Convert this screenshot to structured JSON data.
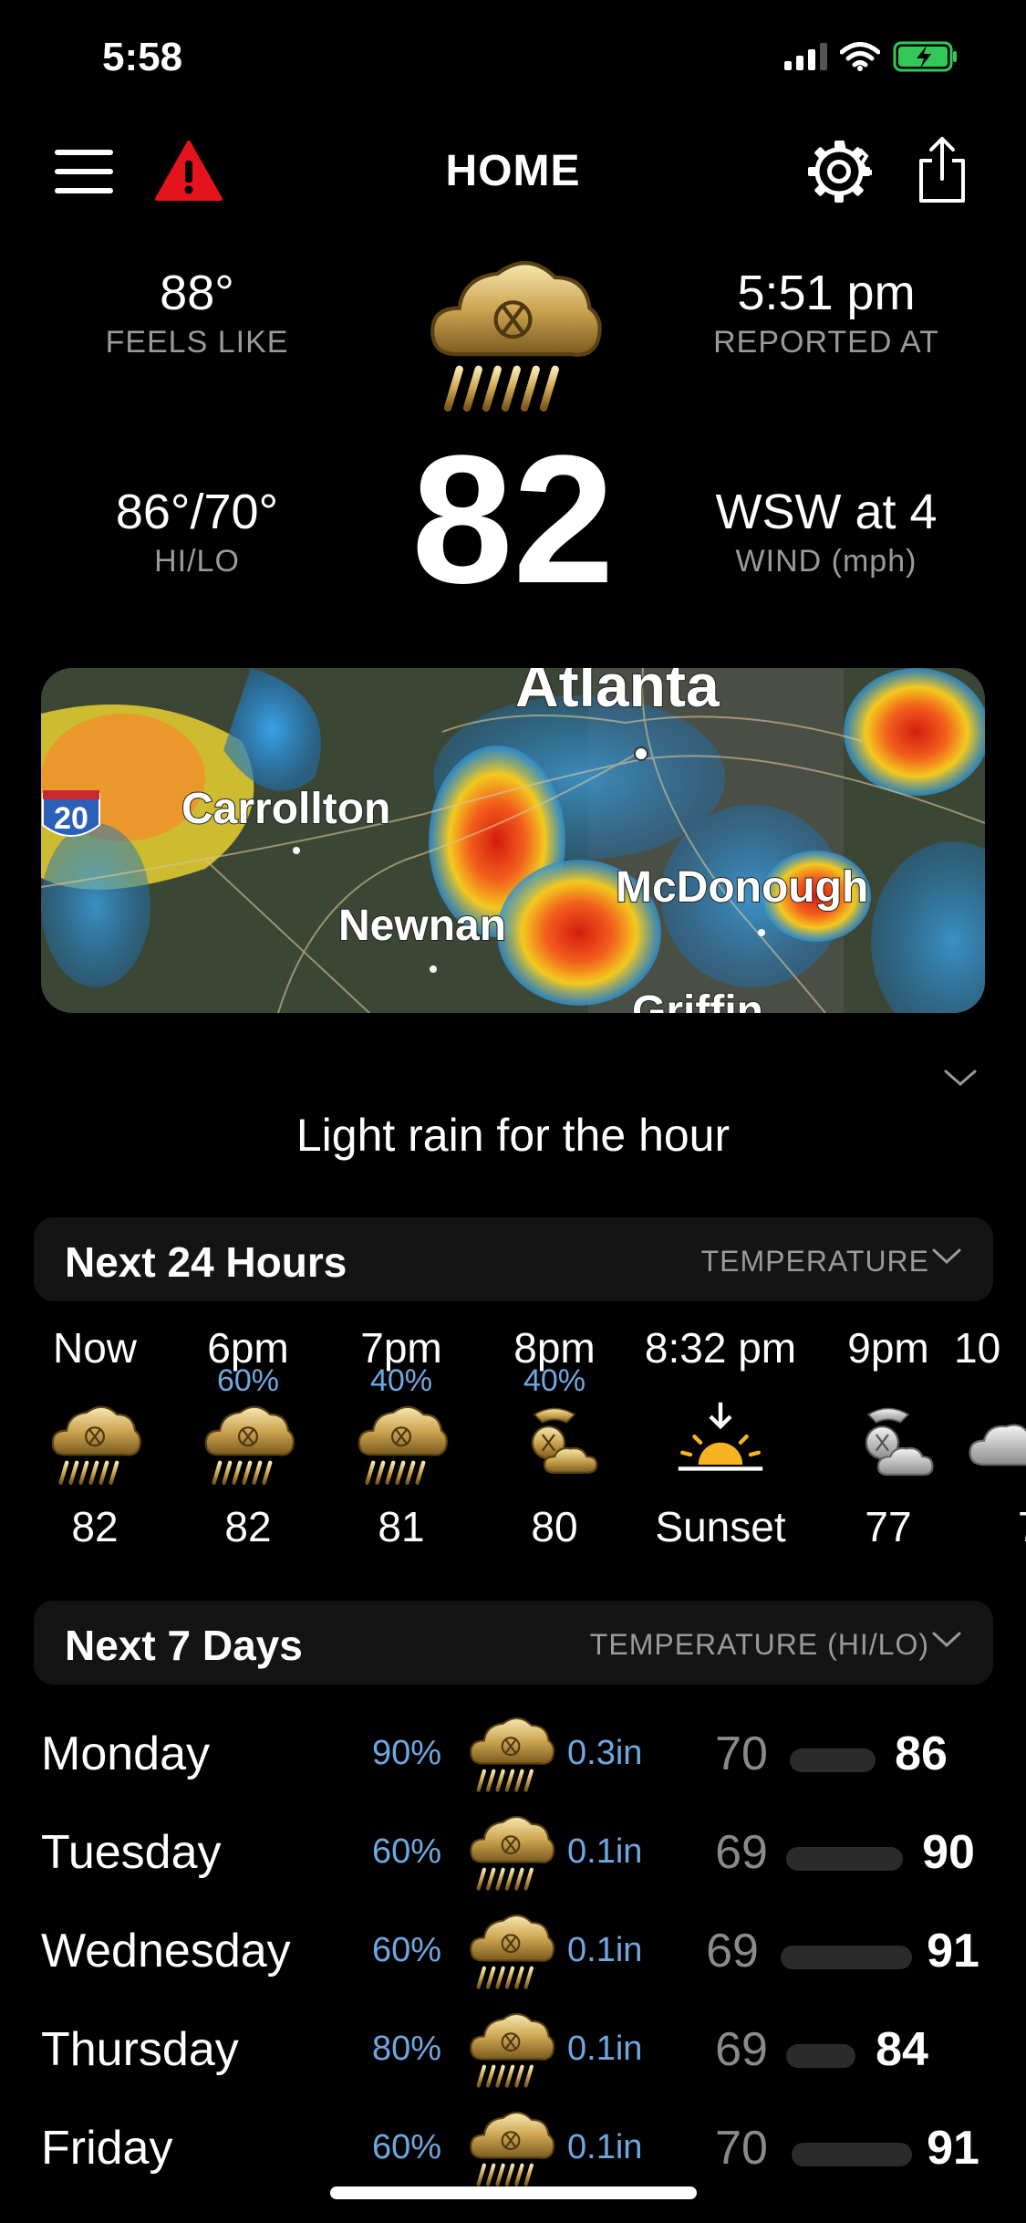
{
  "status_bar": {
    "time": "5:58"
  },
  "header": {
    "title": "HOME"
  },
  "current": {
    "feels_like": {
      "value": "88°",
      "label": "FEELS LIKE"
    },
    "reported_at": {
      "value": "5:51 pm",
      "label": "REPORTED AT"
    },
    "hi_lo": {
      "value": "86°/70°",
      "label": "HI/LO"
    },
    "wind": {
      "value": "WSW at 4",
      "label": "WIND (mph)"
    },
    "temperature": "82",
    "condition_icon": "rain-cloud-icon"
  },
  "radar": {
    "cities": [
      "Atlanta",
      "Carrollton",
      "McDonough",
      "Newnan",
      "Griffin"
    ],
    "interstate_shield": "20"
  },
  "hour_summary": "Light rain for the hour",
  "hourly_section": {
    "title": "Next 24 Hours",
    "mode": "TEMPERATURE"
  },
  "hourly": [
    {
      "time": "Now",
      "pop": "",
      "icon": "rain-cloud-icon",
      "temp": "82"
    },
    {
      "time": "6pm",
      "pop": "60%",
      "icon": "rain-cloud-icon",
      "temp": "82"
    },
    {
      "time": "7pm",
      "pop": "40%",
      "icon": "rain-cloud-icon",
      "temp": "81"
    },
    {
      "time": "8pm",
      "pop": "40%",
      "icon": "partly-cloudy-icon",
      "temp": "80"
    },
    {
      "time": "8:32 pm",
      "pop": "",
      "icon": "sunset-icon",
      "temp": "Sunset"
    },
    {
      "time": "9pm",
      "pop": "",
      "icon": "partly-cloudy-night-icon",
      "temp": "77"
    },
    {
      "time": "10",
      "pop": "",
      "icon": "cloud-icon",
      "temp": "7"
    }
  ],
  "daily_section": {
    "title": "Next 7 Days",
    "mode": "TEMPERATURE (HI/LO)"
  },
  "daily": [
    {
      "day": "Monday",
      "pop": "90%",
      "icon": "rain-cloud-icon",
      "amount": "0.3in",
      "lo": "70",
      "hi": "86"
    },
    {
      "day": "Tuesday",
      "pop": "60%",
      "icon": "rain-cloud-icon",
      "amount": "0.1in",
      "lo": "69",
      "hi": "90"
    },
    {
      "day": "Wednesday",
      "pop": "60%",
      "icon": "rain-cloud-icon",
      "amount": "0.1in",
      "lo": "69",
      "hi": "91"
    },
    {
      "day": "Thursday",
      "pop": "80%",
      "icon": "rain-cloud-icon",
      "amount": "0.1in",
      "lo": "69",
      "hi": "84"
    },
    {
      "day": "Friday",
      "pop": "60%",
      "icon": "rain-cloud-icon",
      "amount": "0.1in",
      "lo": "70",
      "hi": "91"
    }
  ],
  "colors": {
    "accent_blue": "#6fa8e0",
    "alert_red": "#e3141b",
    "battery_green": "#34c759",
    "icon_gold": "#c9a24a"
  }
}
